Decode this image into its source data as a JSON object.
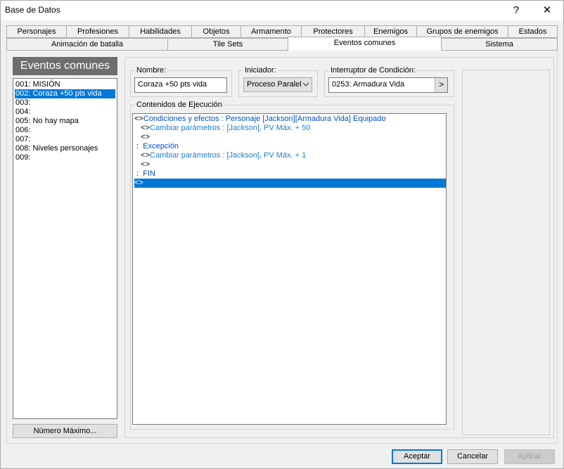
{
  "window": {
    "title": "Base de Datos",
    "help_label": "?",
    "close_label": "✕"
  },
  "tabs": {
    "row1": [
      "Personajes",
      "Profesiones",
      "Habilidades",
      "Objetos",
      "Armamento",
      "Protectores",
      "Enemigos",
      "Grupos de enemigos",
      "Estados"
    ],
    "row2": [
      "Animación de batalla",
      "Tile Sets",
      "Eventos comunes",
      "Sistema"
    ],
    "active": "Eventos comunes"
  },
  "sidebar": {
    "header": "Eventos comunes",
    "items": [
      "001: MISIÓN",
      "002: Coraza +50 pts vida",
      "003:",
      "004:",
      "005: No hay mapa",
      "006:",
      "007:",
      "008: Niveles personajes",
      "009:"
    ],
    "selected_index": 1,
    "max_button": "Número Máximo..."
  },
  "form": {
    "name_label": "Nombre:",
    "name_value": "Coraza +50 pts vida",
    "trigger_label": "Iniciador:",
    "trigger_value": "Proceso Paralel",
    "switch_label": "Interruptor de Condición:",
    "switch_value": "0253: Armadura Vida",
    "switch_btn": ">",
    "contents_label": "Contenidos de Ejecución"
  },
  "commands": [
    {
      "prefix": "<>",
      "text": "Condiciones y efectos : Personaje [Jackson][Armadura Vida] Equipado",
      "style": "blue"
    },
    {
      "prefix": "   <>",
      "text": "Cambiar parámetros : [Jackson], PV Máx. + 50",
      "style": "teal"
    },
    {
      "prefix": "   <>",
      "text": "",
      "style": ""
    },
    {
      "prefix": " :  ",
      "text": "Excepción",
      "style": "blue"
    },
    {
      "prefix": "   <>",
      "text": "Cambiar parámetros : [Jackson], PV Máx. + 1",
      "style": "teal"
    },
    {
      "prefix": "   <>",
      "text": "",
      "style": ""
    },
    {
      "prefix": " :  ",
      "text": "FIN",
      "style": "blue"
    },
    {
      "prefix": "<>",
      "text": "",
      "style": "selected"
    }
  ],
  "buttons": {
    "accept": "Aceptar",
    "cancel": "Cancelar",
    "apply": "Aplicar"
  }
}
